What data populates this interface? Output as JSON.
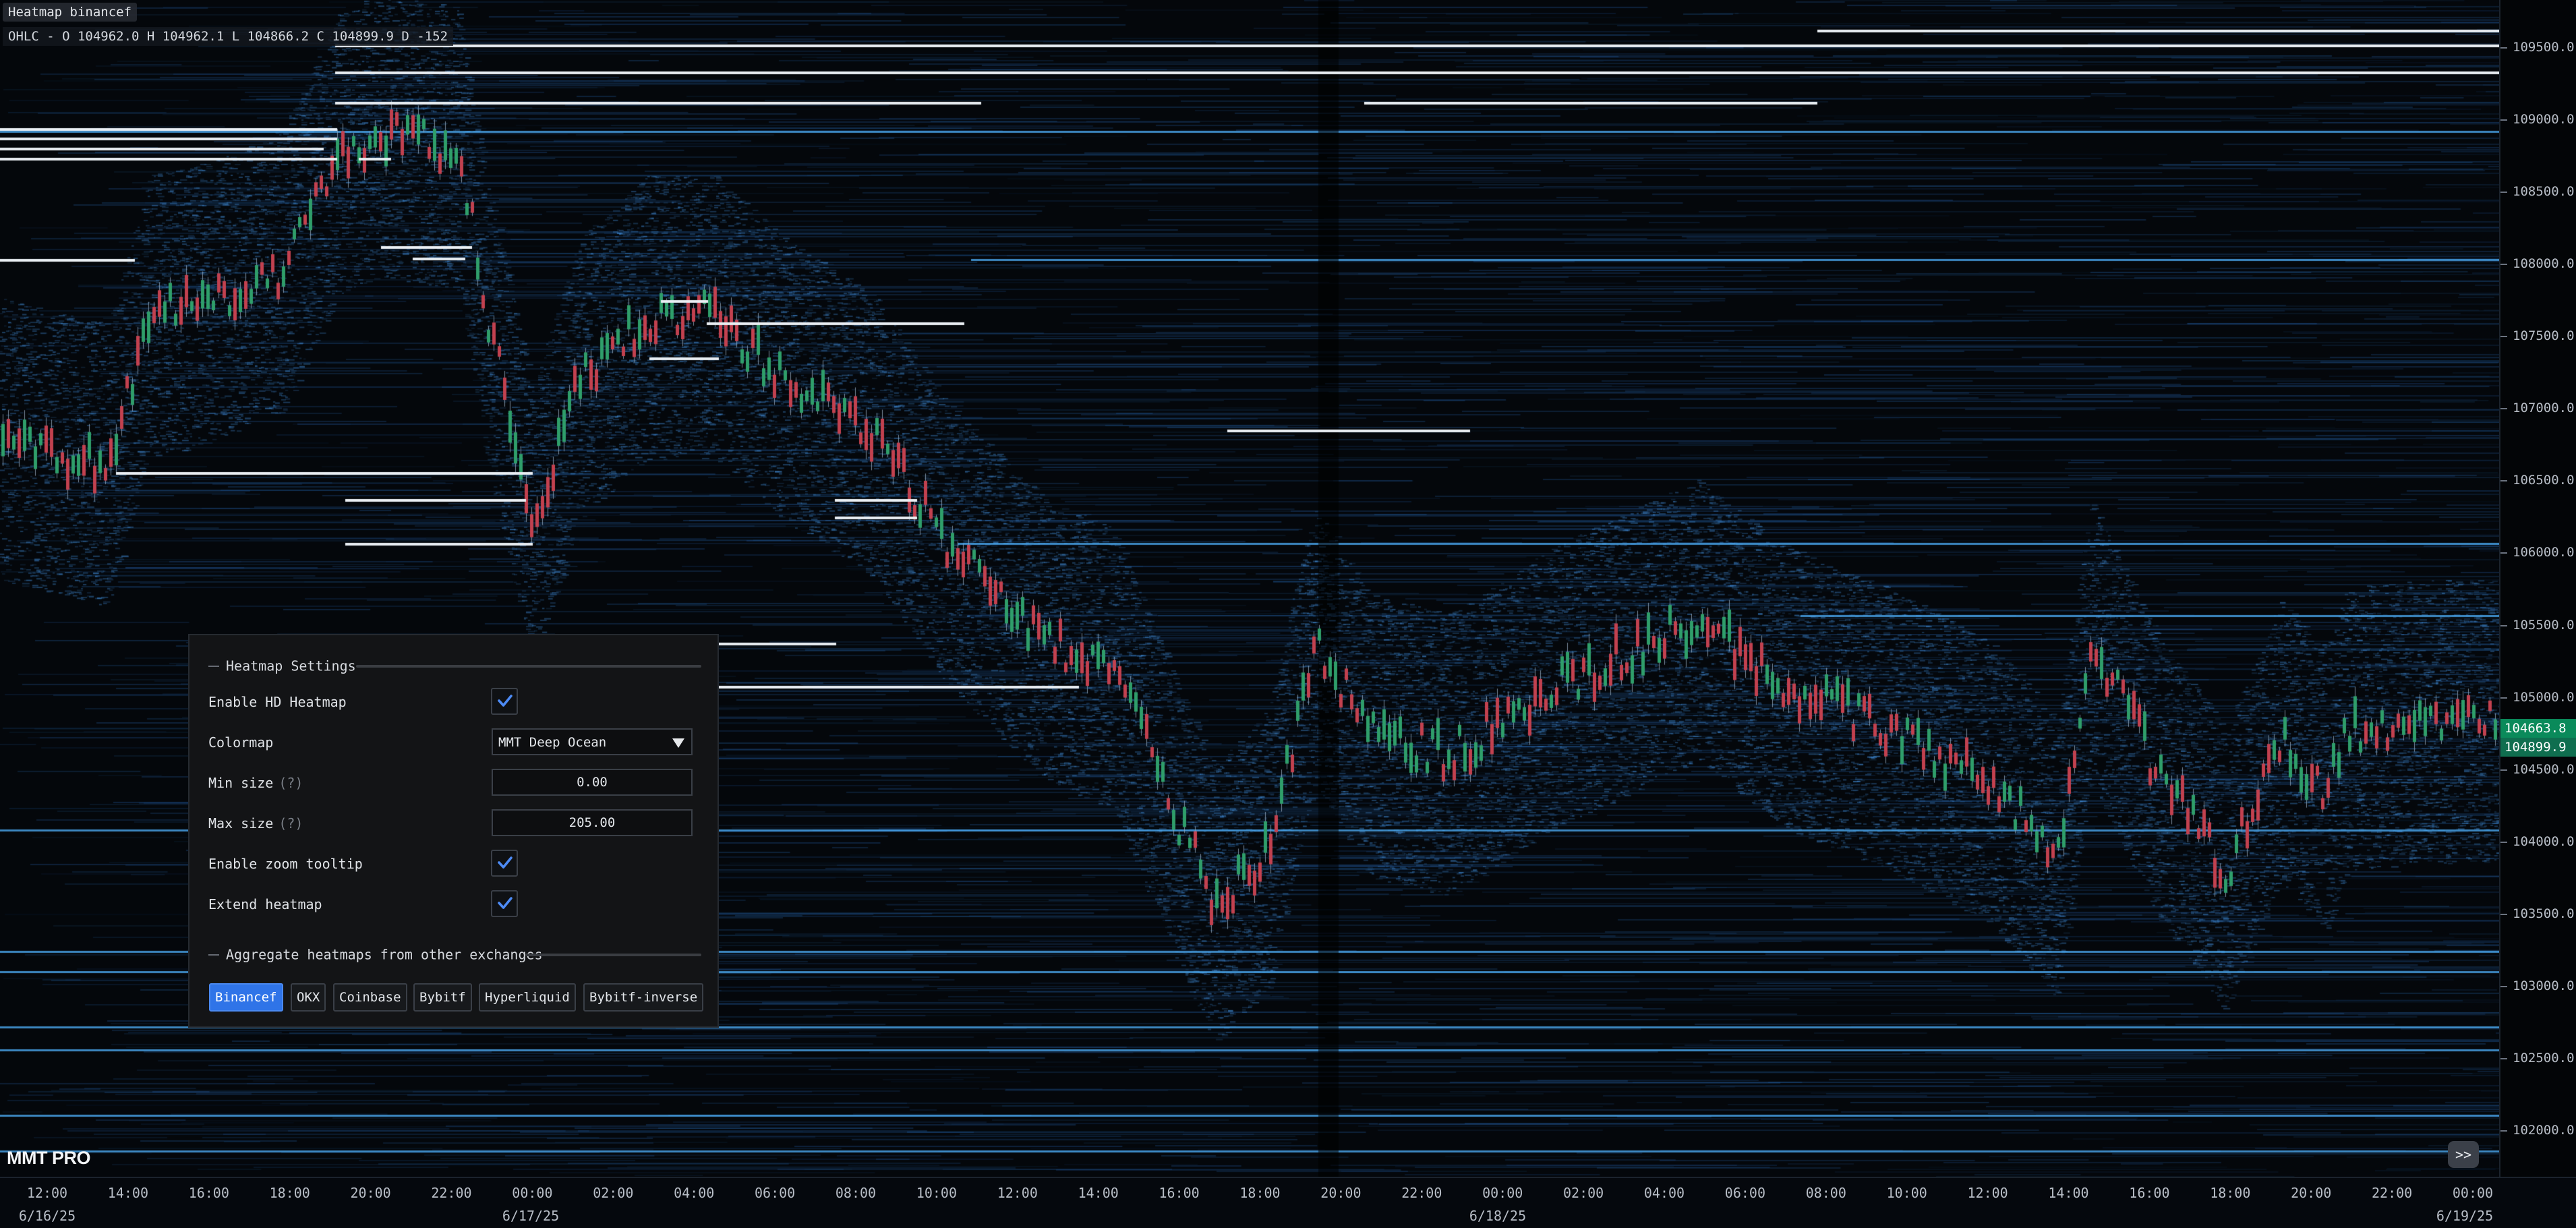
{
  "header": {
    "title": "Heatmap binancef",
    "ohlc": "OHLC - O 104962.0 H 104962.1 L 104866.2 C 104899.9 D -152"
  },
  "brand": "MMT PRO",
  "expand_label": ">>",
  "colors": {
    "background": "#04070b",
    "heat_dim": "#0c2a4d",
    "heat_bright": "#4fb3ff",
    "wall_white": "#e8edf2",
    "candle_up": "#2f9e6a",
    "candle_down": "#c2414f",
    "accent": "#2f74e8",
    "price_badge": "#0a8a5a"
  },
  "price_axis": {
    "labels": [
      "109500.0",
      "109000.0",
      "108500.0",
      "108000.0",
      "107500.0",
      "107000.0",
      "106500.0",
      "106000.0",
      "105500.0",
      "105000.0",
      "104500.0",
      "104000.0",
      "103500.0",
      "103000.0",
      "102500.0",
      "102000.0"
    ],
    "current_price": "104663.8",
    "secondary_price": "104899.9"
  },
  "time_axis": {
    "times": [
      "12:00",
      "14:00",
      "16:00",
      "18:00",
      "20:00",
      "22:00",
      "00:00",
      "02:00",
      "04:00",
      "06:00",
      "08:00",
      "10:00",
      "12:00",
      "14:00",
      "16:00",
      "18:00",
      "20:00",
      "22:00",
      "00:00",
      "02:00",
      "04:00",
      "06:00",
      "08:00",
      "10:00",
      "12:00",
      "14:00",
      "16:00",
      "18:00",
      "20:00",
      "22:00",
      "00:00"
    ],
    "dates": [
      "6/16/25",
      "6/17/25",
      "6/18/25",
      "6/19/25"
    ]
  },
  "settings": {
    "title": "Heatmap Settings",
    "enable_hd_label": "Enable HD Heatmap",
    "enable_hd": true,
    "colormap_label": "Colormap",
    "colormap_value": "MMT Deep Ocean",
    "min_size_label": "Min size",
    "min_size_help": "(?)",
    "min_size_value": "0.00",
    "max_size_label": "Max size",
    "max_size_help": "(?)",
    "max_size_value": "205.00",
    "zoom_tooltip_label": "Enable zoom tooltip",
    "zoom_tooltip": true,
    "extend_label": "Extend heatmap",
    "extend": true,
    "aggregate_title": "Aggregate heatmaps from other exchanges",
    "exchanges": [
      {
        "label": "Binancef",
        "active": true
      },
      {
        "label": "OKX",
        "active": false
      },
      {
        "label": "Coinbase",
        "active": false
      },
      {
        "label": "Bybitf",
        "active": false
      },
      {
        "label": "Hyperliquid",
        "active": false
      },
      {
        "label": "Bybitf-inverse",
        "active": false
      }
    ]
  }
}
